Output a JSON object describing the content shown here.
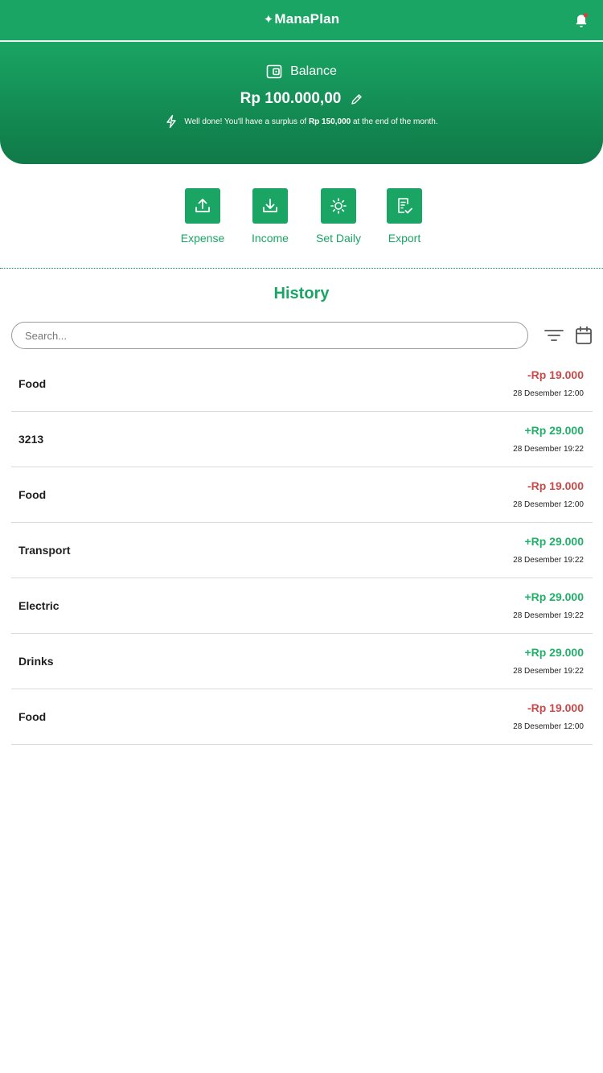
{
  "app": {
    "brand": "ManaPlan"
  },
  "balance": {
    "label": "Balance",
    "amount": "Rp 100.000,00",
    "surplus_prefix": "Well done! You'll have a surplus of",
    "surplus_amount": "Rp 150,000",
    "surplus_suffix": "at the end of the month."
  },
  "actions": [
    {
      "label": "Expense",
      "icon": "upload-icon"
    },
    {
      "label": "Income",
      "icon": "download-icon"
    },
    {
      "label": "Set Daily",
      "icon": "sun-icon"
    },
    {
      "label": "Export",
      "icon": "export-document-icon"
    }
  ],
  "history": {
    "title": "History",
    "search_placeholder": "Search...",
    "items": [
      {
        "name": "Food",
        "amount": "-Rp 19.000",
        "date": "28 Desember 12:00",
        "type": "expense"
      },
      {
        "name": "3213",
        "amount": "+Rp 29.000",
        "date": "28 Desember 19:22",
        "type": "income"
      },
      {
        "name": "Food",
        "amount": "-Rp 19.000",
        "date": "28 Desember 12:00",
        "type": "expense"
      },
      {
        "name": "Transport",
        "amount": "+Rp 29.000",
        "date": "28 Desember 19:22",
        "type": "income"
      },
      {
        "name": "Electric",
        "amount": "+Rp 29.000",
        "date": "28 Desember 19:22",
        "type": "income"
      },
      {
        "name": "Drinks",
        "amount": "+Rp 29.000",
        "date": "28 Desember 19:22",
        "type": "income"
      },
      {
        "name": "Food",
        "amount": "-Rp 19.000",
        "date": "28 Desember 12:00",
        "type": "expense"
      }
    ]
  },
  "colors": {
    "primary": "#1aa564",
    "expense": "#c94a4a",
    "income": "#22b06a",
    "notification_dot": "#e53935"
  }
}
